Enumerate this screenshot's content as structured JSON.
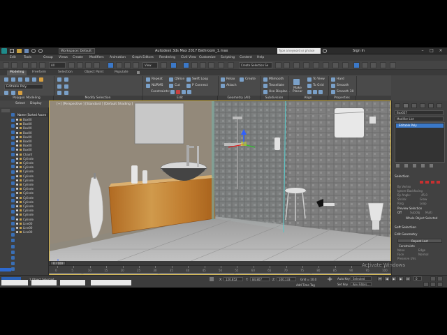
{
  "app": {
    "title": "Autodesk 3ds Max 2017    Bathroom_1.max",
    "workspace": "Workspace: Default",
    "search_placeholder": "Type a keyword or phrase",
    "sign_in": "Sign In"
  },
  "menu": [
    "Edit",
    "Tools",
    "Group",
    "Views",
    "Create",
    "Modifiers",
    "Animation",
    "Graph Editors",
    "Rendering",
    "Civil View",
    "Customize",
    "Scripting",
    "Content",
    "Help"
  ],
  "toolbar": {
    "view_dropdown": "View",
    "selection_set": "Create Selection Se"
  },
  "ribbon": {
    "tabs": [
      "Modeling",
      "Freeform",
      "Selection",
      "Object Paint",
      "Populate"
    ],
    "active_tab": "Modeling",
    "editable_poly": "Editable Poly",
    "commands": {
      "repeat": "Repeat",
      "quickslice": "QSlice",
      "swiftloop": "Swift Loop",
      "nurms": "NURMS",
      "cut": "Cut",
      "pconnect": "P Connect",
      "constraints": "Constraints:",
      "relax": "Relax",
      "create": "Create",
      "attach": "Attach",
      "msmooth": "MSmooth",
      "tessellate": "Tessellate",
      "use_displace": "Use Displac...",
      "make_planar": "Make Planar",
      "to_view": "To View",
      "to_grid": "To Grid",
      "hard": "Hard",
      "smooth": "Smooth",
      "smooth30": "Smooth 30"
    },
    "groups": [
      "Polygon Modeling",
      "Modify Selection",
      "Edit",
      "Geometry (All)",
      "Subdivision",
      "Align",
      "Properties"
    ]
  },
  "scene_explorer": {
    "tabs": [
      "Select",
      "Display"
    ],
    "header": "Name (Sorted Ascen",
    "items": [
      "Box00",
      "Box00",
      "Box00",
      "Box00",
      "Box00",
      "Box00",
      "Box00",
      "Box00",
      "Chamf",
      "Cylinde",
      "Cylinde",
      "Cylinde",
      "Cylinde",
      "Cylinde",
      "Cylinde",
      "Cylinde",
      "Cylinde",
      "Cylinde",
      "Cylinde",
      "Cylinde",
      "Cylinde",
      "Cylinde",
      "Cylinde",
      "Cylinde",
      "Line00",
      "Line00",
      "Line00"
    ]
  },
  "viewport": {
    "label": "[+] [Perspective ] [Standard ] [Default Shading ]"
  },
  "command_panel": {
    "object_name": "Box027",
    "modifier_list": "Modifier List",
    "stack_item": "Editable Poly",
    "rollouts": {
      "selection": "Selection",
      "by_vertex": "By Vertex",
      "ignore_backfacing": "Ignore Backfacing",
      "by_angle": "By Angle:",
      "angle_value": "45.0",
      "shrink": "Shrink",
      "grow": "Grow",
      "ring": "Ring",
      "loop": "Loop",
      "preview_selection": "Preview Selection",
      "off": "Off",
      "subobj": "SubObj",
      "multi": "Multi",
      "whole_object": "Whole Object Selected",
      "soft_selection": "Soft Selection",
      "edit_geometry": "Edit Geometry",
      "repeat_last": "Repeat Last",
      "constraints": "Constraints",
      "none": "None",
      "edge": "Edge",
      "face": "Face",
      "normal": "Normal",
      "preserve_uvs": "Preserve UVs"
    }
  },
  "timeline": {
    "frame": "0 / 100",
    "ticks": [
      "0",
      "5",
      "10",
      "15",
      "20",
      "25",
      "30",
      "35",
      "40",
      "45",
      "50",
      "55",
      "60",
      "65",
      "70",
      "75",
      "80",
      "85",
      "90",
      "95",
      "100"
    ]
  },
  "status": {
    "objects_selected": "1 Object Selected",
    "x_label": "X:",
    "x_value": "120.852",
    "y_label": "Y:",
    "y_value": "84.807",
    "z_label": "Z:",
    "z_value": "100.133",
    "grid": "Grid = 10.0",
    "add_time_tag": "Add Time Tag",
    "auto_key": "Auto Key",
    "selected": "Selected",
    "set_key": "Set Key",
    "key_filters": "Key Filters...",
    "frame_input": "0"
  },
  "watermark": "Activate Windows"
}
